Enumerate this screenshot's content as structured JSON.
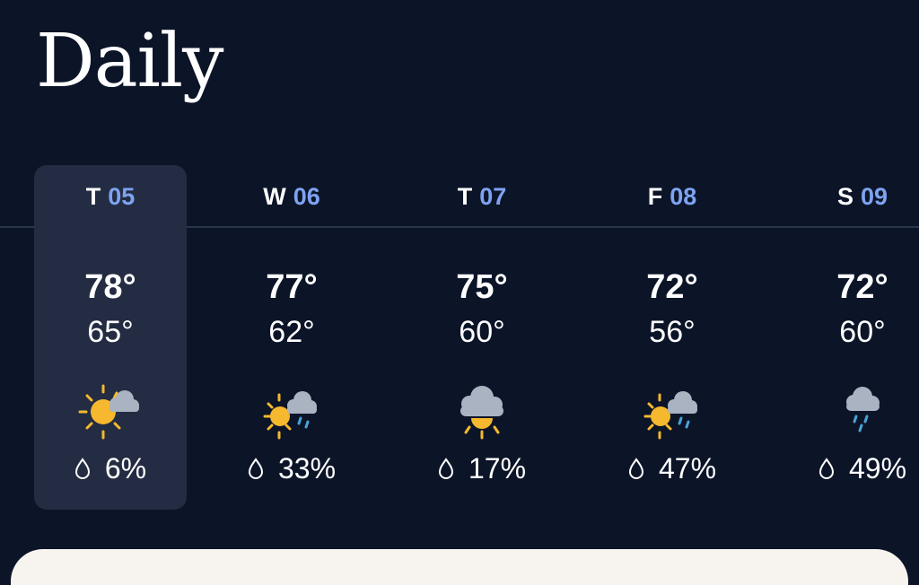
{
  "title": "Daily",
  "days": [
    {
      "dow": "T",
      "date": "05",
      "high": "78°",
      "low": "65°",
      "precip": "6%",
      "icon": "partly-cloudy-sun-icon"
    },
    {
      "dow": "W",
      "date": "06",
      "high": "77°",
      "low": "62°",
      "precip": "33%",
      "icon": "sun-cloud-rain-icon"
    },
    {
      "dow": "T",
      "date": "07",
      "high": "75°",
      "low": "60°",
      "precip": "17%",
      "icon": "cloud-sun-icon"
    },
    {
      "dow": "F",
      "date": "08",
      "high": "72°",
      "low": "56°",
      "precip": "47%",
      "icon": "sun-cloud-rain-icon"
    },
    {
      "dow": "S",
      "date": "09",
      "high": "72°",
      "low": "60°",
      "precip": "49%",
      "icon": "cloud-rain-icon"
    }
  ],
  "colors": {
    "background": "#0c1428",
    "selected": "#232c42",
    "date_accent": "#7ea3f0",
    "sun": "#f5b82e",
    "cloud": "#aab3c2",
    "rain": "#4aa3d8"
  }
}
